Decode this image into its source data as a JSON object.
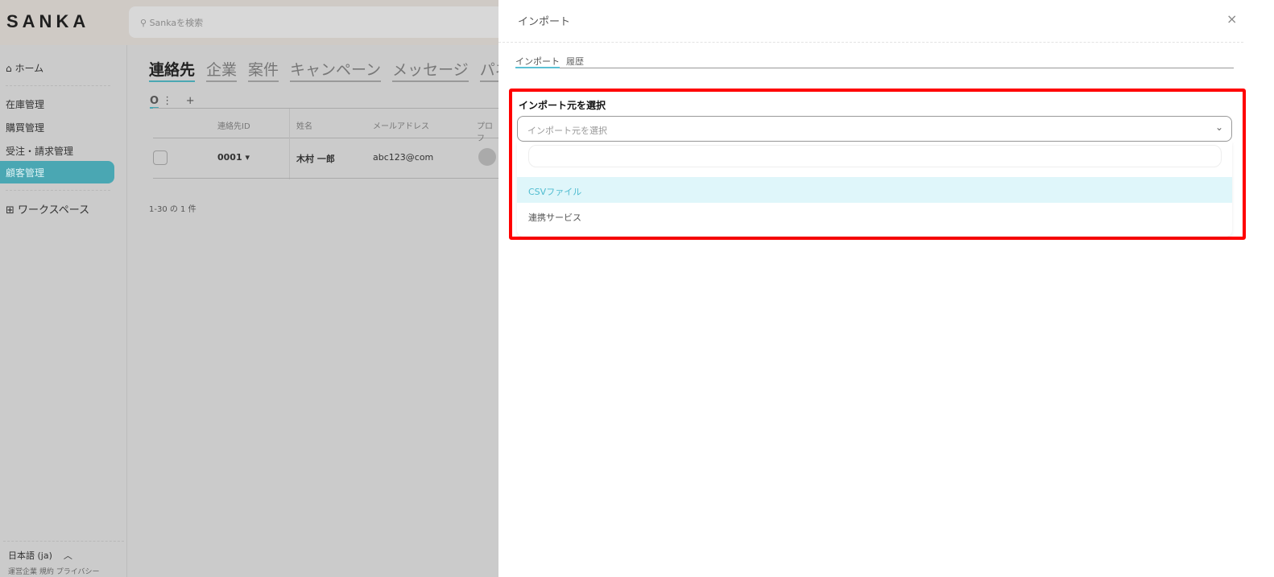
{
  "header": {
    "logo": "SANKA",
    "search_placeholder": "Sankaを検索"
  },
  "sidebar": {
    "home": "ホーム",
    "items": [
      "在庫管理",
      "購買管理",
      "受注・請求管理",
      "顧客管理"
    ],
    "active_index": 3,
    "workspace": "ワークスペース",
    "language": "日本語 (ja)",
    "footer": "運営企業 規約 プライバシー"
  },
  "main": {
    "tabs": [
      "連絡先",
      "企業",
      "案件",
      "キャンペーン",
      "メッセージ",
      "パネル"
    ],
    "columns": [
      "連絡先ID",
      "姓名",
      "メールアドレス",
      "プロフ"
    ],
    "rows": [
      {
        "id": "0001",
        "name": "木村 一郎",
        "email": "abc123@com"
      }
    ],
    "pagination": "1-30 の 1 件",
    "add": "+"
  },
  "panel": {
    "title": "インポート",
    "close": "×",
    "tabs": [
      "インポート",
      "履歴"
    ],
    "field_label": "インポート元を選択",
    "select_placeholder": "インポート元を選択",
    "options": [
      "CSVファイル",
      "連携サービス"
    ],
    "highlight_color": "#dff6fa",
    "accent": "#4aa7b3"
  }
}
